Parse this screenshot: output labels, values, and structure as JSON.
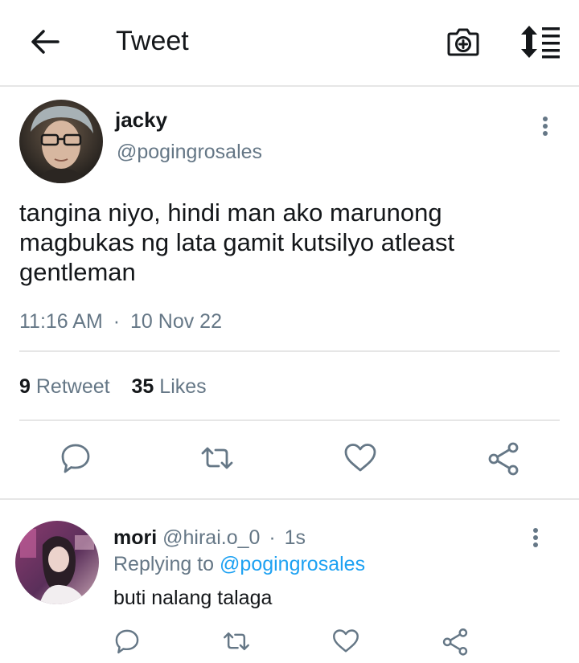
{
  "header": {
    "title": "Tweet",
    "icons": {
      "back": "arrow-left-icon",
      "camera": "camera-plus-icon",
      "sort": "sort-icon"
    }
  },
  "tweet": {
    "display_name": "jacky",
    "handle": "@pogingrosales",
    "text": "tangina niyo, hindi man ako marunong magbukas ng lata gamit kutsilyo atleast gentleman",
    "time": "11:16 AM",
    "separator": "·",
    "date": "10 Nov 22",
    "retweet_count": "9",
    "retweet_label": "Retweet",
    "likes_count": "35",
    "likes_label": "Likes",
    "actions": [
      "reply-icon",
      "retweet-icon",
      "like-icon",
      "share-icon"
    ]
  },
  "reply": {
    "display_name": "mori",
    "handle": "@hirai.o_0",
    "separator": "·",
    "age": "1s",
    "replying_prefix": "Replying to",
    "replying_to": "@pogingrosales",
    "text": "buti nalang talaga",
    "actions": [
      "reply-icon",
      "retweet-icon",
      "like-icon",
      "share-icon"
    ]
  },
  "colors": {
    "text_primary": "#14171a",
    "text_secondary": "#657786",
    "link": "#1da1f2",
    "divider": "#e6e6e6"
  }
}
